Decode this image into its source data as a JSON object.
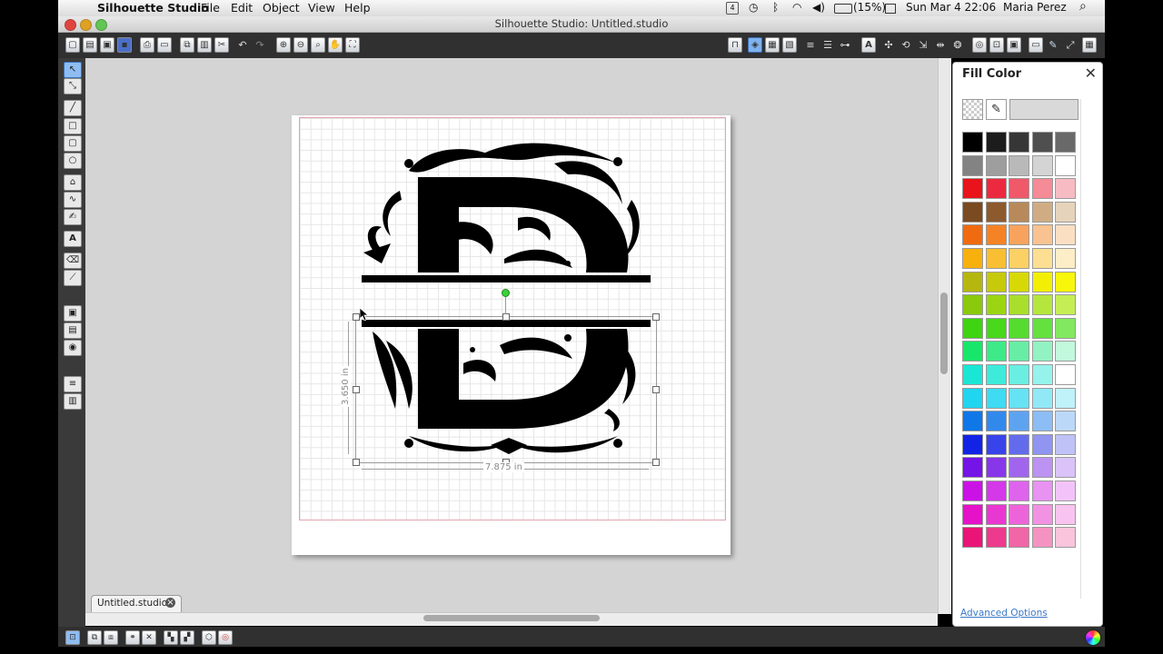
{
  "menubar": {
    "app_name": "Silhouette Studio",
    "menus": [
      "File",
      "Edit",
      "Object",
      "View",
      "Help"
    ],
    "battery": "(15%)",
    "datetime": "Sun Mar 4  22:06",
    "user": "Maria Perez",
    "badge": "4"
  },
  "window": {
    "title": "Silhouette Studio: Untitled.studio"
  },
  "canvas": {
    "width_label": "7.875 in",
    "height_label": "3.650 in",
    "monogram_letter": "D"
  },
  "document_tab": {
    "label": "Untitled.studio",
    "close_glyph": "×"
  },
  "fill_panel": {
    "title": "Fill Color",
    "close_glyph": "✕",
    "advanced_options": "Advanced Options",
    "colors": [
      [
        "#000000",
        "#1c1c1c",
        "#363636",
        "#4f4f4f",
        "#696969"
      ],
      [
        "#838383",
        "#9e9e9e",
        "#b9b9b9",
        "#d4d4d4",
        "#ffffff"
      ],
      [
        "#e8131b",
        "#ec2a3f",
        "#ef5969",
        "#f48b96",
        "#f7bcc3"
      ],
      [
        "#7a4a20",
        "#8c5a2d",
        "#b88a5b",
        "#d0ac84",
        "#e6d3bb"
      ],
      [
        "#f06b0f",
        "#f58326",
        "#f7a35d",
        "#f9c291",
        "#fbdfc3"
      ],
      [
        "#f8b00d",
        "#f9bf32",
        "#fbd165",
        "#fcdf92",
        "#fdeec7"
      ],
      [
        "#b6b70e",
        "#c7c90b",
        "#d7d906",
        "#f2ef05",
        "#f8f60b"
      ],
      [
        "#8ac90c",
        "#9bd512",
        "#a9de2c",
        "#b5e63d",
        "#c5ee55"
      ],
      [
        "#3ed411",
        "#48d81c",
        "#55dc2f",
        "#64e13f",
        "#82e85f"
      ],
      [
        "#17e66a",
        "#3ee988",
        "#68eda5",
        "#93f2c1",
        "#c2f8dc"
      ],
      [
        "#1ae6d5",
        "#3eeada",
        "#6aeee2",
        "#95f3eb",
        "#ffffff"
      ],
      [
        "#20d5f0",
        "#3edbf2",
        "#66e2f4",
        "#91e9f7",
        "#c0f2fa"
      ],
      [
        "#1077e8",
        "#3289ec",
        "#5ea3f0",
        "#8cbdf4",
        "#bcd8f9"
      ],
      [
        "#1323e6",
        "#3844e9",
        "#636bed",
        "#8f95f1",
        "#bfc2f7"
      ],
      [
        "#7414e6",
        "#8737e9",
        "#a165ed",
        "#bc92f2",
        "#dac3f8"
      ],
      [
        "#cb12e6",
        "#d438e9",
        "#de64ed",
        "#e892f2",
        "#f2c3f8"
      ],
      [
        "#e612c9",
        "#e938d1",
        "#ed64da",
        "#f292e3",
        "#f8c3ee"
      ],
      [
        "#ea1477",
        "#ed3a8c",
        "#f066a6",
        "#f493c1",
        "#f9c4dc"
      ]
    ]
  },
  "icons": {
    "apple": "",
    "search": "⌕",
    "wifi": "◠",
    "volume": "◀)",
    "bluetooth": "ᛒ",
    "clock": "◷"
  }
}
